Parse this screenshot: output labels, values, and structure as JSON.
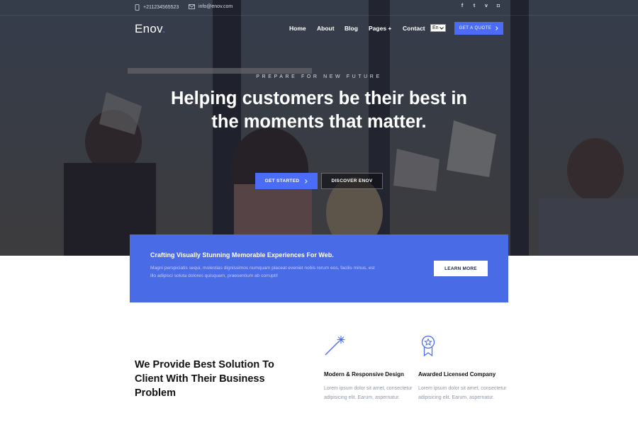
{
  "topbar": {
    "phone": "+211234565523",
    "email": "info@enov.com",
    "socials": [
      {
        "name": "facebook-icon",
        "glyph": "f"
      },
      {
        "name": "twitter-icon",
        "glyph": "t"
      },
      {
        "name": "vimeo-icon",
        "glyph": "v"
      },
      {
        "name": "instagram-icon",
        "glyph": "◘"
      }
    ]
  },
  "header": {
    "logo": "Enov",
    "logo_dot": ".",
    "nav": [
      "Home",
      "About",
      "Blog",
      "Pages +",
      "Contact"
    ],
    "language": "En",
    "quote_label": "GET A QUOTE"
  },
  "hero": {
    "eyebrow": "PREPARE FOR NEW FUTURE",
    "headline": "Helping customers be their best in the moments that matter.",
    "primary_button": "GET STARTED",
    "secondary_button": "DISCOVER ENOV"
  },
  "cta": {
    "title": "Crafting Visually Stunning Memorable Experiences For Web.",
    "body": "Magni perspiciatis sequi, molestias dignissimos numquam placeat eveniet nobis rerum eos, facilis minus, est illo adipisci soluta dolores quisquam, praesentium ab corrupti!",
    "button": "LEARN MORE"
  },
  "solutions": {
    "title": "We Provide Best Solution To Client With Their Business Problem",
    "features": [
      {
        "icon": "magic-wand-icon",
        "title": "Modern & Responsive Design",
        "text": "Lorem ipsum dolor sit amet, consectetur adipisicing elit. Earum, aspernatur."
      },
      {
        "icon": "award-badge-icon",
        "title": "Awarded Licensed Company",
        "text": "Lorem ipsum dolor sit amet, consectetur adipisicing elit. Earum, aspernatur."
      }
    ]
  },
  "colors": {
    "accent": "#4a6cf7",
    "cta_band": "#4a6be6",
    "hero_overlay": "#14162380"
  }
}
